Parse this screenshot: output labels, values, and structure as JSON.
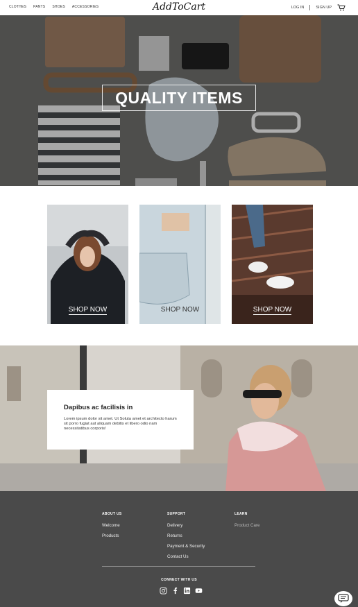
{
  "header": {
    "nav": [
      "CLOTHES",
      "PANTS",
      "SHOES",
      "ACCESSORIES"
    ],
    "logo": "AddToCart",
    "login": "LOG IN",
    "signup": "SIGN UP",
    "cart_icon": "cart-icon"
  },
  "hero": {
    "title": "QUALITY ITEMS"
  },
  "cards": [
    {
      "label": "SHOP NOW"
    },
    {
      "label": "SHOP NOW"
    },
    {
      "label": "SHOP NOW"
    }
  ],
  "promo": {
    "title": "Dapibus ac facilisis in",
    "text": "Lorem ipsum dolor sit amet. Ut Soluta amet et architecto harum sit porro fugiat aut aliquam debitis et libero odio nam necessitatibus corporis!"
  },
  "footer": {
    "about": {
      "heading": "ABOUT US",
      "links": [
        "Welcome",
        "Products"
      ]
    },
    "support": {
      "heading": "SUPPORT",
      "links": [
        "Delivery",
        "Returns",
        "Payment & Security",
        "Contact Us"
      ]
    },
    "learn": {
      "heading": "LEARN",
      "links": [
        "Product Care"
      ]
    },
    "connect": "CONNECT WITH US",
    "social_icons": [
      "instagram-icon",
      "facebook-icon",
      "linkedin-icon",
      "youtube-icon"
    ]
  },
  "colors": {
    "footer_bg": "#4a4a4a",
    "hero_bg": "#6e6d6b"
  }
}
